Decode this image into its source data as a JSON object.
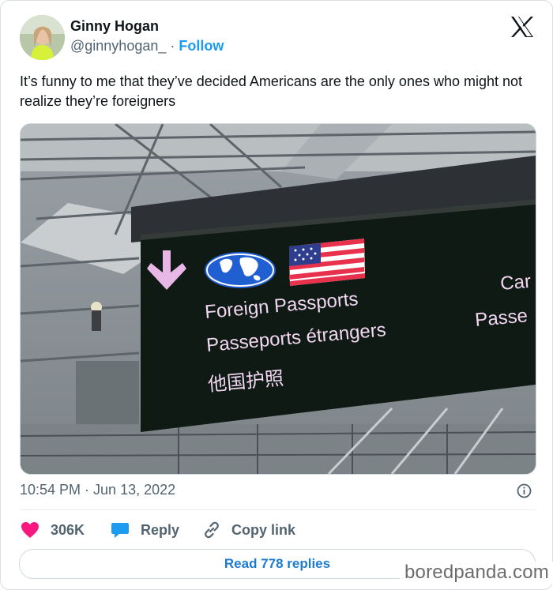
{
  "author": {
    "name": "Ginny Hogan",
    "handle": "@ginnyhogan_",
    "separator": "·",
    "follow_label": "Follow"
  },
  "tweet": {
    "text": "It’s funny to me that they’ve decided Americans are the only ones who might not realize they’re foreigners",
    "timestamp": "10:54 PM · Jun 13, 2022"
  },
  "photo": {
    "sign_line_1": "Foreign Passports",
    "sign_line_2": "Passeports étrangers",
    "sign_line_3": "他国护照",
    "sign_right_1": "Car",
    "sign_right_2": "Passe"
  },
  "actions": {
    "like_count": "306K",
    "reply_label": "Reply",
    "copy_link_label": "Copy link",
    "read_replies_label": "Read 778 replies"
  },
  "watermark": "boredpanda.com",
  "colors": {
    "like": "#f91880",
    "reply": "#1d9bf0",
    "link": "#1d9bf0",
    "text": "#0f1419",
    "muted": "#536471"
  },
  "icons": [
    "x-logo-icon",
    "heart-icon",
    "reply-bubble-icon",
    "link-icon",
    "info-icon",
    "down-arrow-icon",
    "globe-icon",
    "us-flag-icon"
  ]
}
